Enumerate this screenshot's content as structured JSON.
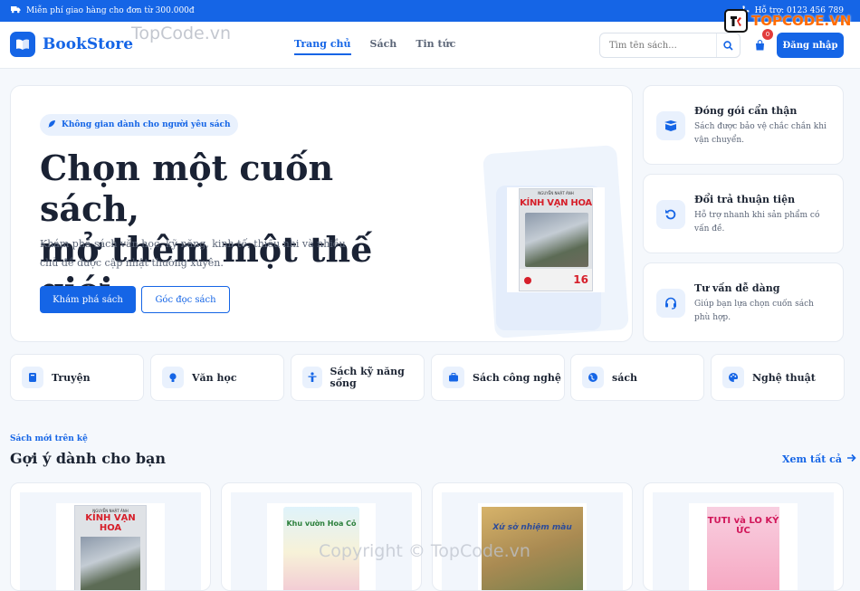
{
  "topbar": {
    "promo": "Miễn phí giao hàng cho đơn từ 300.000đ",
    "hotline": "Hỗ trợ: 0123 456 789"
  },
  "header": {
    "brand": "BookStore",
    "nav": [
      "Trang chủ",
      "Sách",
      "Tin tức"
    ],
    "search_placeholder": "Tìm tên sách...",
    "cart_count": "0",
    "login": "Đăng nhập"
  },
  "hero": {
    "tag": "Không gian dành cho người yêu sách",
    "title_line1": "Chọn một cuốn sách,",
    "title_line2": "mở thêm một thế giới",
    "subtitle": "Khám phá sách văn học, kỹ năng, kinh tế, thiếu nhi và nhiều chủ đề được cập nhật thường xuyên.",
    "primary_button": "Khám phá sách",
    "secondary_button": "Góc đọc sách",
    "book": {
      "author": "NGUYỄN NHẬT ÁNH",
      "title": "KÍNH VẠN HOA",
      "number": "16"
    }
  },
  "features": [
    {
      "title": "Đóng gói cẩn thận",
      "desc": "Sách được bảo vệ chắc chắn khi vận chuyển.",
      "icon": "box-icon"
    },
    {
      "title": "Đổi trả thuận tiện",
      "desc": "Hỗ trợ nhanh khi sản phẩm có vấn đề.",
      "icon": "return-icon"
    },
    {
      "title": "Tư vấn dễ dàng",
      "desc": "Giúp bạn lựa chọn cuốn sách phù hợp.",
      "icon": "headset-icon"
    }
  ],
  "categories": [
    {
      "label": "Truyện",
      "icon": "book-icon"
    },
    {
      "label": "Văn học",
      "icon": "bulb-icon"
    },
    {
      "label": "Sách kỹ năng sống",
      "icon": "person-icon"
    },
    {
      "label": "Sách công nghệ",
      "icon": "briefcase-icon"
    },
    {
      "label": "sách",
      "icon": "globe-icon"
    },
    {
      "label": "Nghệ thuật",
      "icon": "palette-icon"
    }
  ],
  "section": {
    "kicker": "Sách mới trên kệ",
    "title": "Gợi ý dành cho bạn",
    "see_all": "Xem tất cả"
  },
  "products": [
    {
      "author": "NGUYỄN NHẬT ÁNH",
      "title": "KÍNH VẠN HOA"
    },
    {
      "title": "Khu vườn Hoa Cỏ"
    },
    {
      "title": "Xứ sở nhiệm màu"
    },
    {
      "title": "TUTI và LO KÝ ỨC"
    }
  ],
  "watermarks": {
    "top": "TopCode.vn",
    "bottom": "Copyright © TopCode.vn",
    "logo": "TOPCODE.VN"
  },
  "colors": {
    "accent": "#1565e6",
    "badge": "#e23b3b"
  }
}
